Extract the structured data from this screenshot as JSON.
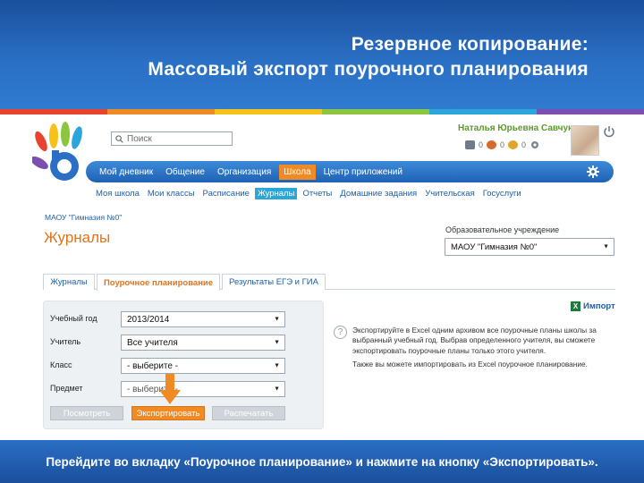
{
  "slide": {
    "title_line1": "Резервное копирование:",
    "title_line2": "Массовый экспорт поурочного планирования",
    "footer_text": "Перейдите во вкладку «Поурочное планирование» и нажмите на кнопку «Экспортировать»."
  },
  "colors": {
    "header_blue": "#2a6fc4",
    "accent_orange": "#f08a24",
    "link_blue": "#1d5fa8",
    "user_green": "#5b9a2e",
    "stripe": [
      "#e8432e",
      "#f08a24",
      "#f5c219",
      "#8cc63f",
      "#2aa7d8",
      "#7a4fb0"
    ]
  },
  "search": {
    "placeholder": "Поиск",
    "icon": "search-icon"
  },
  "user": {
    "name": "Наталья Юрьевна Савчук",
    "counters": [
      {
        "icon": "mail-icon",
        "count": "0"
      },
      {
        "icon": "people-icon",
        "count": "0"
      },
      {
        "icon": "groups-icon",
        "count": "0"
      }
    ],
    "gear_icon": "gear-icon",
    "power_icon": "power-icon"
  },
  "main_nav": [
    {
      "label": "Мой дневник",
      "active": false
    },
    {
      "label": "Общение",
      "active": false
    },
    {
      "label": "Организация",
      "active": false
    },
    {
      "label": "Школа",
      "active": true
    },
    {
      "label": "Центр приложений",
      "active": false
    }
  ],
  "sub_nav": [
    {
      "label": "Моя школа",
      "active": false
    },
    {
      "label": "Мои классы",
      "active": false
    },
    {
      "label": "Расписание",
      "active": false
    },
    {
      "label": "Журналы",
      "active": true
    },
    {
      "label": "Отчеты",
      "active": false
    },
    {
      "label": "Домашние задания",
      "active": false
    },
    {
      "label": "Учительская",
      "active": false
    },
    {
      "label": "Госуслуги",
      "active": false
    }
  ],
  "page": {
    "org_crumb": "МАОУ \"Гимназия №0\"",
    "title": "Журналы",
    "institution_label": "Образовательное учреждение",
    "institution_value": "МАОУ \"Гимназия №0\""
  },
  "tabs": [
    {
      "label": "Журналы",
      "active": false
    },
    {
      "label": "Поурочное планирование",
      "active": true
    },
    {
      "label": "Результаты ЕГЭ и ГИА",
      "active": false
    }
  ],
  "form": {
    "year_label": "Учебный год",
    "year_value": "2013/2014",
    "teacher_label": "Учитель",
    "teacher_value": "Все учителя",
    "class_label": "Класс",
    "class_value": "- выберите -",
    "subject_label": "Предмет",
    "subject_value": "- выберите -",
    "view_button": "Посмотреть",
    "export_button": "Экспортировать",
    "print_button": "Распечатать"
  },
  "info": {
    "import_label": "Импорт",
    "import_icon": "excel-icon",
    "text1": "Экспортируйте в Excel одним архивом все поурочные планы школы за выбранный учебный год. Выбрав определенного учителя, вы сможете экспортировать поурочные планы только этого учителя.",
    "text2": "Также вы можете импортировать из Excel поурочное планирование."
  }
}
